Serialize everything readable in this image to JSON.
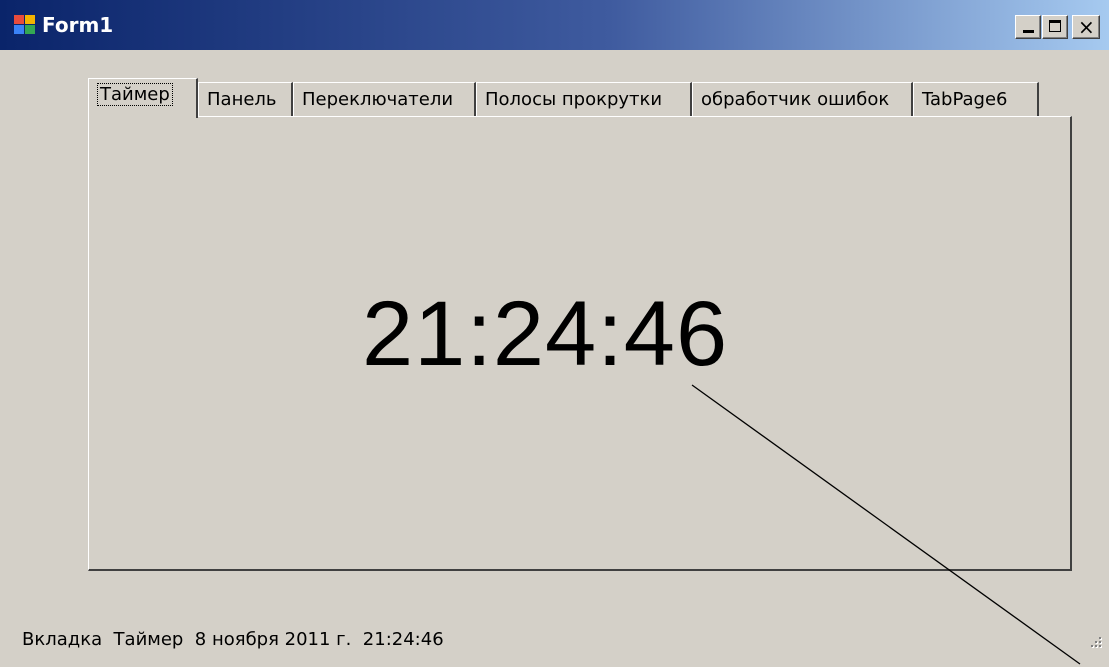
{
  "window": {
    "title": "Form1",
    "icon": "windows-form-icon",
    "buttons": {
      "minimize": "minimize-icon",
      "maximize": "maximize-icon",
      "close": "×"
    }
  },
  "tabs": [
    {
      "label": "Таймер",
      "active": true
    },
    {
      "label": "Панель",
      "active": false
    },
    {
      "label": "Переключатели",
      "active": false
    },
    {
      "label": "Полосы прокрутки",
      "active": false
    },
    {
      "label": "обработчик ошибок",
      "active": false
    },
    {
      "label": "TabPage6",
      "active": false
    }
  ],
  "timer": {
    "time": "21:24:46"
  },
  "status": {
    "text": "Вкладка  Таймер  8 ноября 2011 г.  21:24:46"
  },
  "colors": {
    "window_bg": "#d4d0c8",
    "titlebar_start": "#0a246a",
    "titlebar_end": "#a6caf0",
    "title_text": "#ffffff"
  }
}
